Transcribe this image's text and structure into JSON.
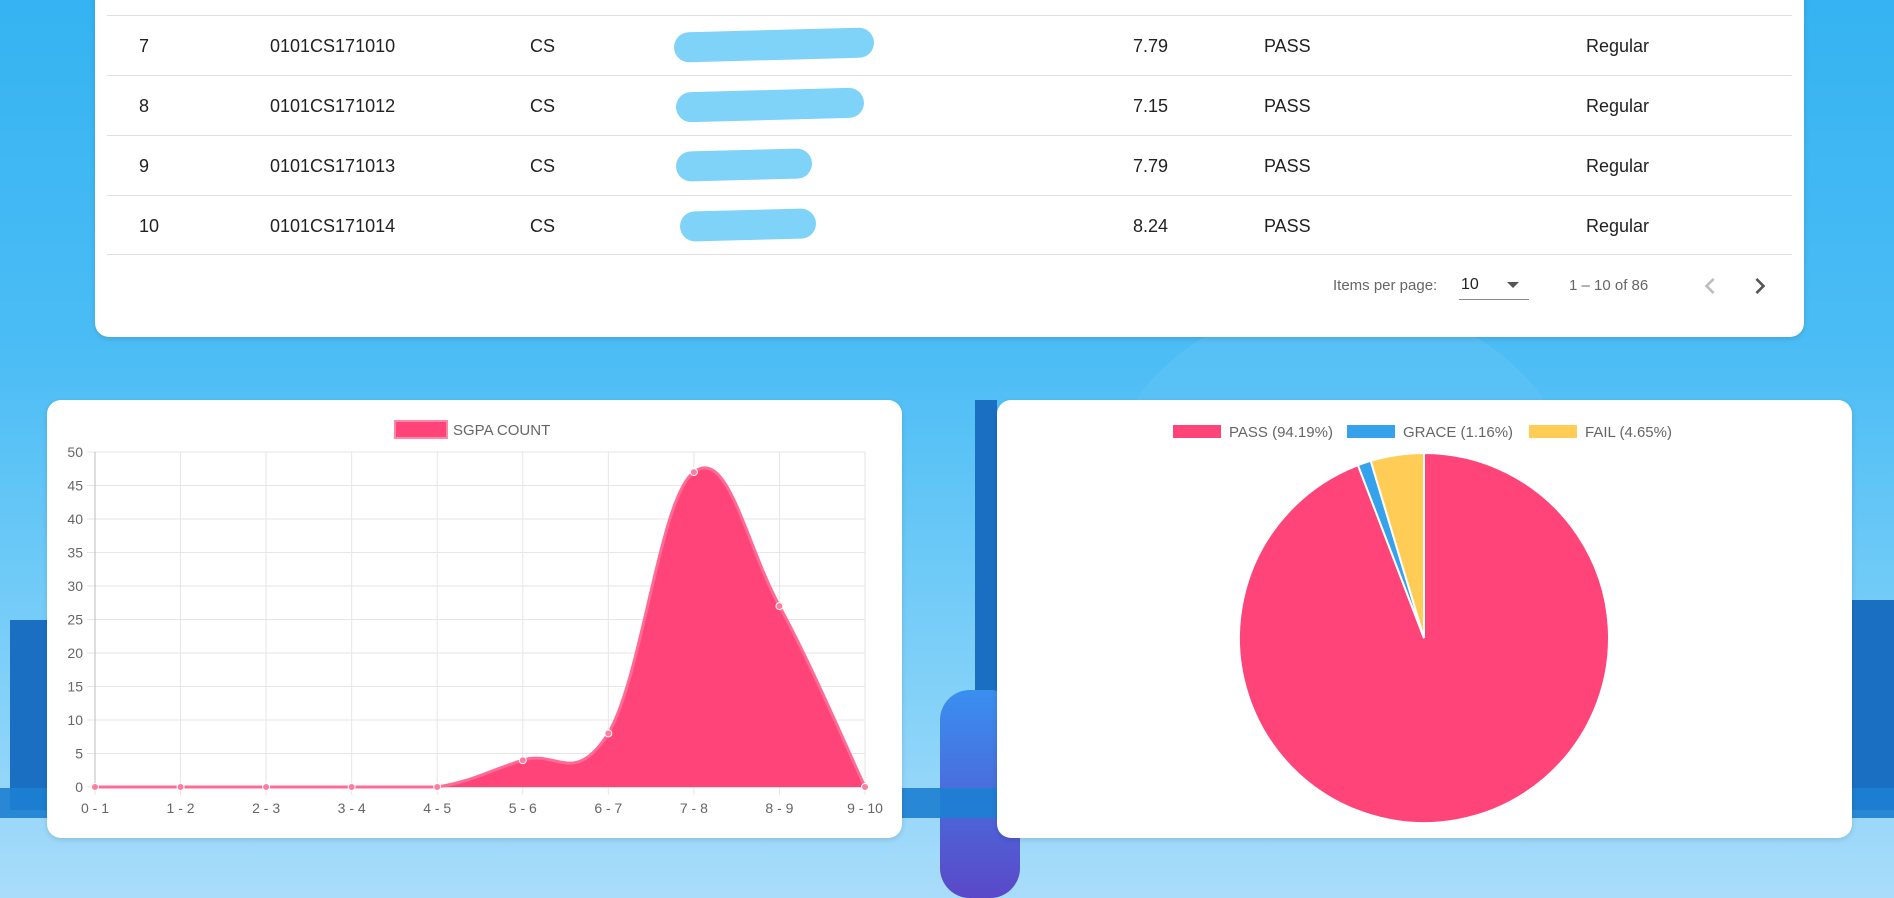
{
  "table": {
    "rows": [
      {
        "sno": "7",
        "roll": "0101CS171010",
        "branch": "CS",
        "name": "",
        "sgpa": "7.79",
        "result": "PASS",
        "type": "Regular"
      },
      {
        "sno": "8",
        "roll": "0101CS171012",
        "branch": "CS",
        "name": "",
        "sgpa": "7.15",
        "result": "PASS",
        "type": "Regular"
      },
      {
        "sno": "9",
        "roll": "0101CS171013",
        "branch": "CS",
        "name": "",
        "sgpa": "7.79",
        "result": "PASS",
        "type": "Regular"
      },
      {
        "sno": "10",
        "roll": "0101CS171014",
        "branch": "CS",
        "name": "",
        "sgpa": "8.24",
        "result": "PASS",
        "type": "Regular"
      }
    ],
    "paginator": {
      "items_per_page_label": "Items per page:",
      "items_per_page_value": "10",
      "range": "1 – 10 of 86",
      "prev_icon": "chevron-left-icon",
      "next_icon": "chevron-right-icon"
    }
  },
  "colors": {
    "pink": "#ff4479",
    "blue": "#36a2eb",
    "yellow": "#ffcd56",
    "redaction": "#7fd2f8"
  },
  "chart_data": [
    {
      "type": "area",
      "legend": [
        "SGPA COUNT"
      ],
      "categories": [
        "0 - 1",
        "1 - 2",
        "2 - 3",
        "3 - 4",
        "4 - 5",
        "5 - 6",
        "6 - 7",
        "7 - 8",
        "8 - 9",
        "9 - 10"
      ],
      "series": [
        {
          "name": "SGPA COUNT",
          "values": [
            0,
            0,
            0,
            0,
            0,
            4,
            8,
            47,
            27,
            0
          ]
        }
      ],
      "ylim": [
        0,
        50
      ],
      "yticks": [
        0,
        5,
        10,
        15,
        20,
        25,
        30,
        35,
        40,
        45,
        50
      ],
      "grid": true,
      "legend_position": "top"
    },
    {
      "type": "pie",
      "labels": [
        "PASS (94.19%)",
        "GRACE (1.16%)",
        "FAIL (4.65%)"
      ],
      "values": [
        94.19,
        1.16,
        4.65
      ],
      "legend_position": "top"
    }
  ]
}
